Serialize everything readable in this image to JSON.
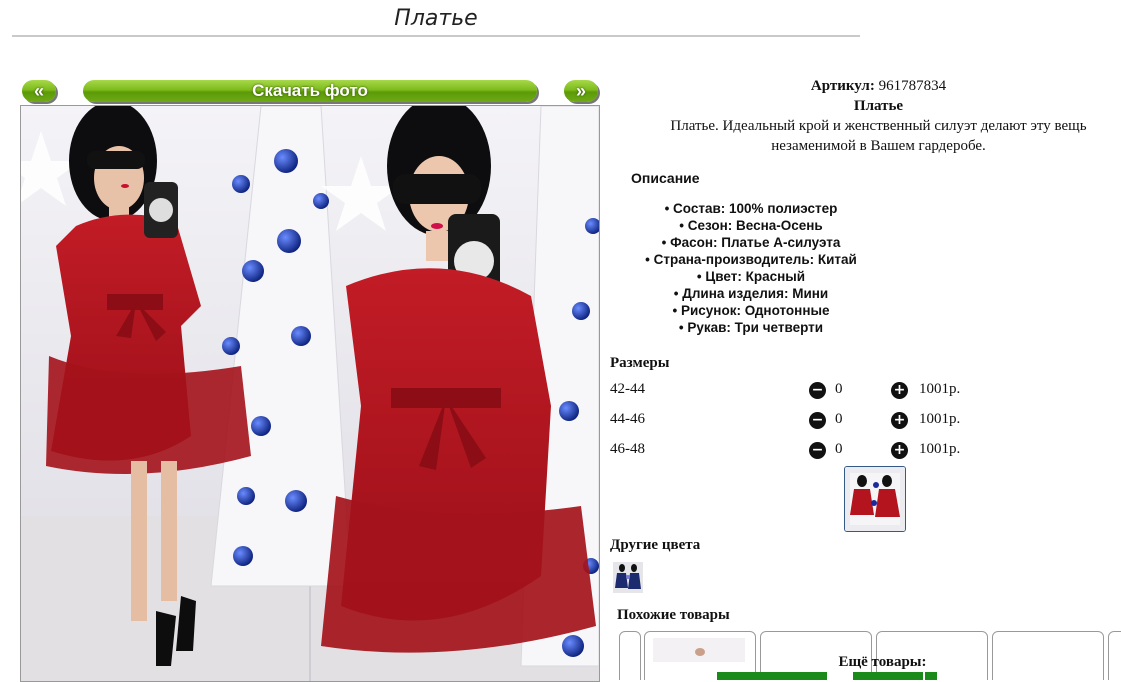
{
  "page": {
    "title": "Платье"
  },
  "gallery": {
    "prev_label": "«",
    "next_label": "»",
    "download_label": "Скачать фото"
  },
  "product": {
    "article_label": "Артикул:",
    "article_value": "961787834",
    "name": "Платье",
    "description": "Платье. Идеальный крой и женственный силуэт делают эту вещь незаменимой в Вашем гардеробе.",
    "description_heading": "Описание",
    "specs": [
      "Состав: 100% полиэстер",
      "Сезон: Весна-Осень",
      "Фасон: Платье А-силуэта",
      "Страна-производитель: Китай",
      "Цвет: Красный",
      "Длина изделия: Мини",
      "Рисунок: Однотонные",
      "Рукав: Три четверти"
    ]
  },
  "sizes": {
    "heading": "Размеры",
    "rows": [
      {
        "size": "42-44",
        "qty": "0",
        "price": "1001р."
      },
      {
        "size": "44-46",
        "qty": "0",
        "price": "1001р."
      },
      {
        "size": "46-48",
        "qty": "0",
        "price": "1001р."
      }
    ]
  },
  "other_colors": {
    "heading": "Другие цвета"
  },
  "similar": {
    "heading": "Похожие товары"
  },
  "more": {
    "heading": "Ещё товары:"
  },
  "colors": {
    "button_green": "#7dbb1c",
    "dress_red": "#b3141e",
    "accent_blue": "#355a8a",
    "link_green": "#1a8a1a"
  }
}
